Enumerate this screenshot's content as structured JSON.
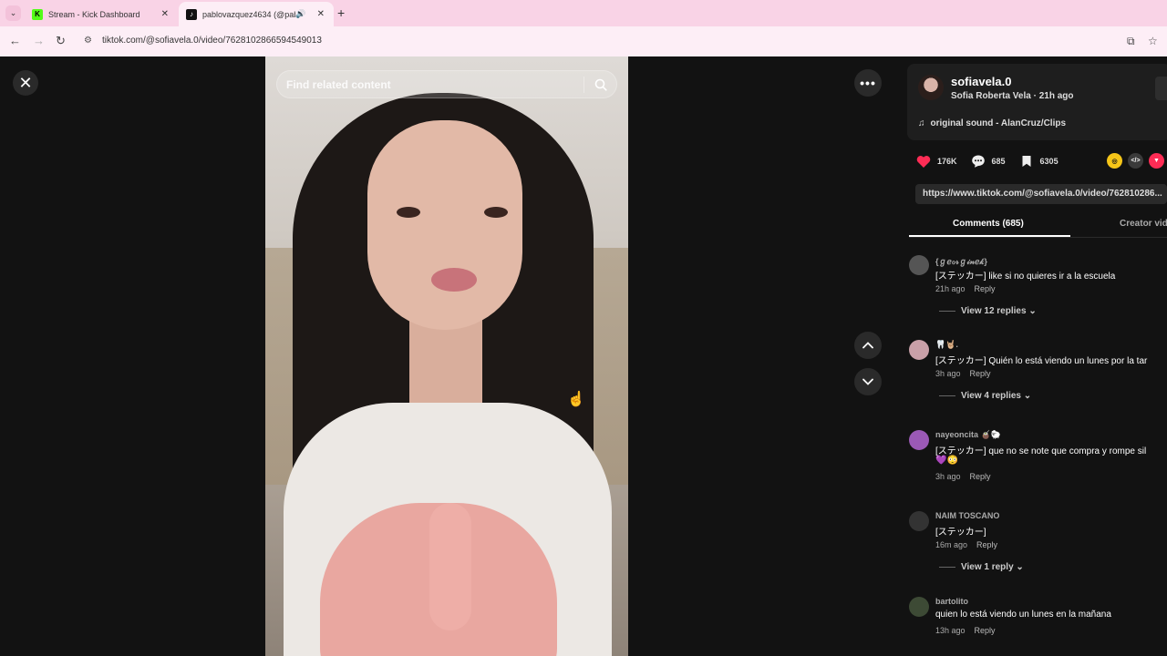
{
  "browser": {
    "tabs": [
      {
        "title": "Stream - Kick Dashboard",
        "favicon": "kick-logo"
      },
      {
        "title": "pablovazquez4634 (@pabl",
        "favicon": "tiktok-logo",
        "audio": true
      }
    ],
    "url": "tiktok.com/@sofiavela.0/video/7628102866594549013"
  },
  "player": {
    "search_placeholder": "Find related content"
  },
  "creator": {
    "username": "sofiavela.0",
    "subline": "Sofia Roberta Vela · 21h ago",
    "sound": "original sound - AlanCruz/Clips"
  },
  "stats": {
    "likes": "176K",
    "comments": "685",
    "saves": "6305"
  },
  "share_link": "https://www.tiktok.com/@sofiavela.0/video/762810286...",
  "panel_tabs": {
    "comments": "Comments (685)",
    "creator_videos": "Creator vid"
  },
  "comments": [
    {
      "name": "{ℊℯℴ𝓇ℊ𝒾𝓃ℯ𝓀}",
      "text": "[ステッカー] like si no quieres ir a la escuela",
      "time": "21h ago",
      "reply": "Reply",
      "view_replies": "View 12 replies"
    },
    {
      "name": "🦷🤘🏼.",
      "text": "[ステッカー] Quién lo está viendo un lunes por la tar",
      "time": "3h ago",
      "reply": "Reply",
      "view_replies": "View 4 replies"
    },
    {
      "name": "nayeoncita 🧉🐑",
      "text": "[ステッカー] que no se note que compra y rompe sil",
      "text2": "💜😳",
      "time": "3h ago",
      "reply": "Reply"
    },
    {
      "name": "NAIM TOSCANO",
      "text": "[ステッカー]",
      "time": "16m ago",
      "reply": "Reply",
      "view_replies": "View 1 reply"
    },
    {
      "name": "bartolito",
      "text": "quien lo está viendo un lunes en la mañana",
      "time": "13h ago",
      "reply": "Reply"
    }
  ],
  "colors": {
    "like": "#fe2c55",
    "kick": "#53fc18",
    "tab_bar": "#f9d3e6"
  }
}
